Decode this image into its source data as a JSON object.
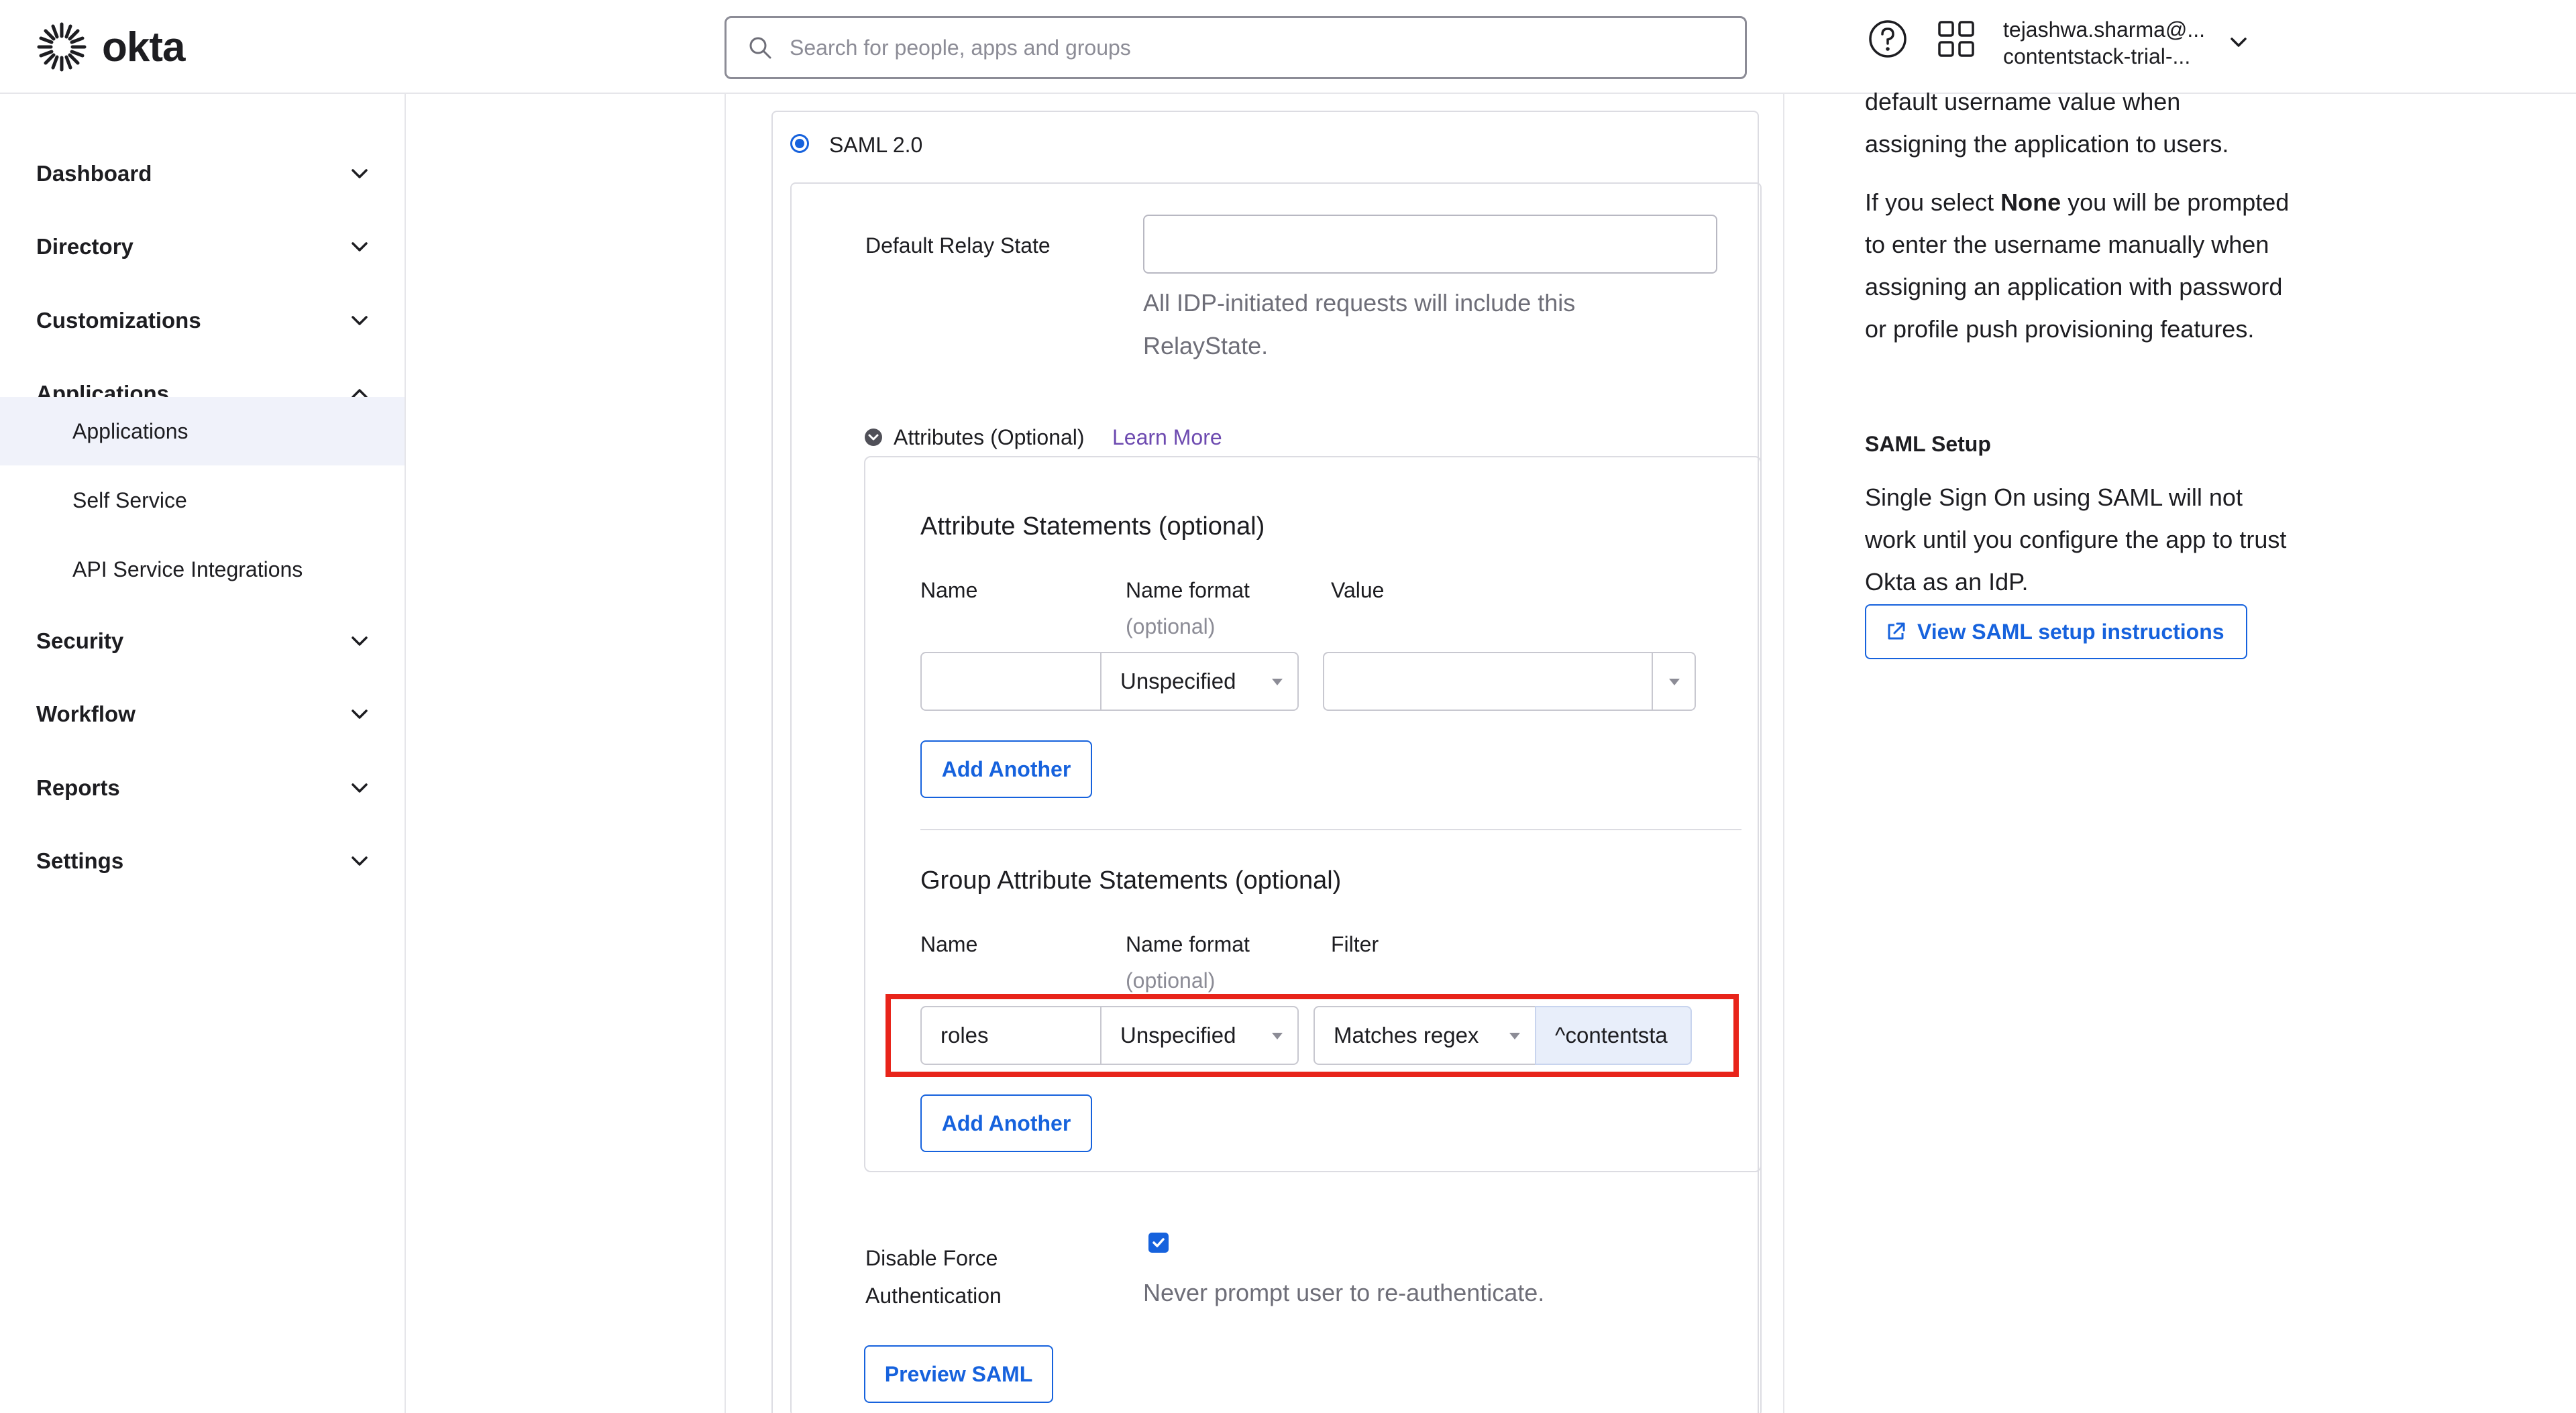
{
  "header": {
    "logo_text": "okta",
    "search_placeholder": "Search for people, apps and groups",
    "user_line1": "tejashwa.sharma@...",
    "user_line2": "contentstack-trial-..."
  },
  "sidebar": {
    "items": [
      {
        "label": "Dashboard"
      },
      {
        "label": "Directory"
      },
      {
        "label": "Customizations"
      },
      {
        "label": "Applications"
      },
      {
        "label": "Security"
      },
      {
        "label": "Workflow"
      },
      {
        "label": "Reports"
      },
      {
        "label": "Settings"
      }
    ],
    "sub_items": [
      {
        "label": "Applications",
        "active": true
      },
      {
        "label": "Self Service"
      },
      {
        "label": "API Service Integrations"
      }
    ]
  },
  "saml": {
    "radio_label": "SAML 2.0",
    "relay_state_label": "Default Relay State",
    "relay_state_value": "",
    "relay_help_line1": "All IDP-initiated requests will include this",
    "relay_help_line2": "RelayState.",
    "attributes_label": "Attributes (Optional)",
    "learn_more": "Learn More",
    "attr_statements": {
      "title": "Attribute Statements (optional)",
      "col_name": "Name",
      "col_format": "Name format",
      "col_format_sub": "(optional)",
      "col_value": "Value",
      "name_value": "",
      "format_value": "Unspecified",
      "value_value": "",
      "add_button": "Add Another"
    },
    "group_statements": {
      "title": "Group Attribute Statements (optional)",
      "col_name": "Name",
      "col_format": "Name format",
      "col_format_sub": "(optional)",
      "col_filter": "Filter",
      "name_value": "roles",
      "format_value": "Unspecified",
      "filter_type": "Matches regex",
      "filter_value": "^contentsta",
      "add_button": "Add Another"
    },
    "force_auth_label_line1": "Disable Force",
    "force_auth_label_line2": "Authentication",
    "force_auth_checked": true,
    "force_auth_help": "Never prompt user to re-authenticate.",
    "preview_button": "Preview SAML"
  },
  "right_help": {
    "para1_line1": "default username value when",
    "para1_line2": "assigning the application to users.",
    "para2_prefix": "If you select ",
    "para2_bold": "None",
    "para2_suffix": " you will be prompted to enter the username manually when assigning an application with password or profile push provisioning features.",
    "saml_setup_heading": "SAML Setup",
    "saml_setup_text": "Single Sign On using SAML will not work until you configure the app to trust Okta as an IdP.",
    "view_instructions_button": "View SAML setup instructions"
  },
  "colors": {
    "accent": "#1662dd",
    "highlight": "#e8241a",
    "learn_more": "#6d4ab0"
  }
}
